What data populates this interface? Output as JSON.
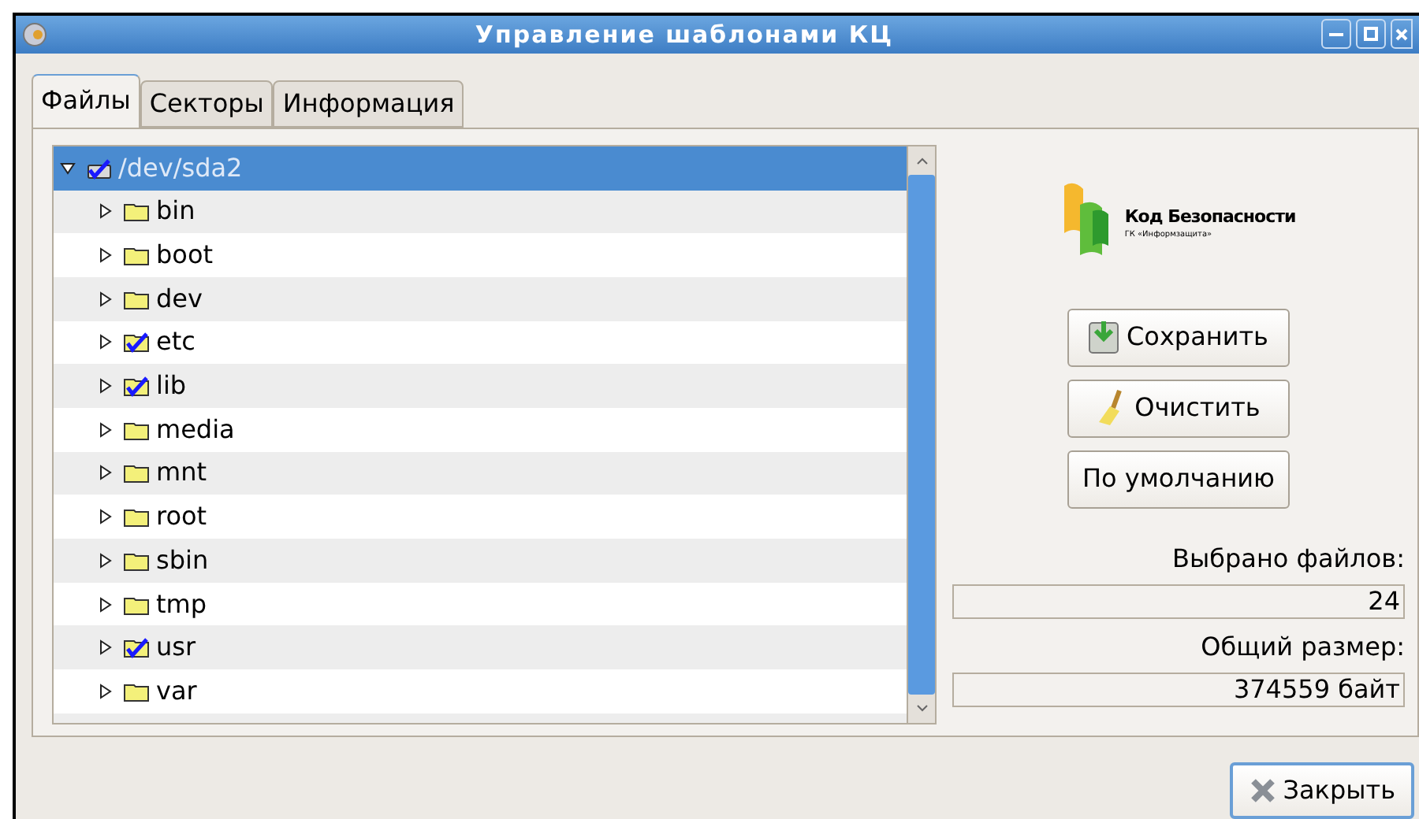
{
  "window": {
    "title": "Управление шаблонами КЦ"
  },
  "tabs": [
    {
      "label": "Файлы",
      "selected": true
    },
    {
      "label": "Секторы",
      "selected": false
    },
    {
      "label": "Информация",
      "selected": false
    }
  ],
  "tree": [
    {
      "label": "/dev/sda2",
      "kind": "disk",
      "expanded": true,
      "checked": true,
      "selected": true,
      "children": [
        {
          "label": "bin",
          "expanded": false,
          "checked": false,
          "selected": false
        },
        {
          "label": "boot",
          "expanded": false,
          "checked": false,
          "selected": false
        },
        {
          "label": "dev",
          "expanded": false,
          "checked": false,
          "selected": false
        },
        {
          "label": "etc",
          "expanded": false,
          "checked": true,
          "selected": false
        },
        {
          "label": "lib",
          "expanded": false,
          "checked": true,
          "selected": false
        },
        {
          "label": "media",
          "expanded": false,
          "checked": false,
          "selected": false
        },
        {
          "label": "mnt",
          "expanded": false,
          "checked": false,
          "selected": false
        },
        {
          "label": "root",
          "expanded": false,
          "checked": false,
          "selected": false
        },
        {
          "label": "sbin",
          "expanded": false,
          "checked": false,
          "selected": false
        },
        {
          "label": "tmp",
          "expanded": false,
          "checked": false,
          "selected": false
        },
        {
          "label": "usr",
          "expanded": false,
          "checked": true,
          "selected": false
        },
        {
          "label": "var",
          "expanded": false,
          "checked": false,
          "selected": false
        }
      ]
    }
  ],
  "logo": {
    "name": "Код Безопасности",
    "subtitle": "ГК «Информзащита»"
  },
  "buttons": [
    {
      "label": "Сохранить",
      "kind": "save"
    },
    {
      "label": "Очистить",
      "kind": "clear"
    },
    {
      "label": "По умолчанию",
      "kind": "plain"
    }
  ],
  "stats": [
    {
      "label": "Выбрано файлов:",
      "value": "24"
    },
    {
      "label": "Общий размер:",
      "value": "374559 байт"
    }
  ],
  "close_button": {
    "label": "Закрыть"
  }
}
